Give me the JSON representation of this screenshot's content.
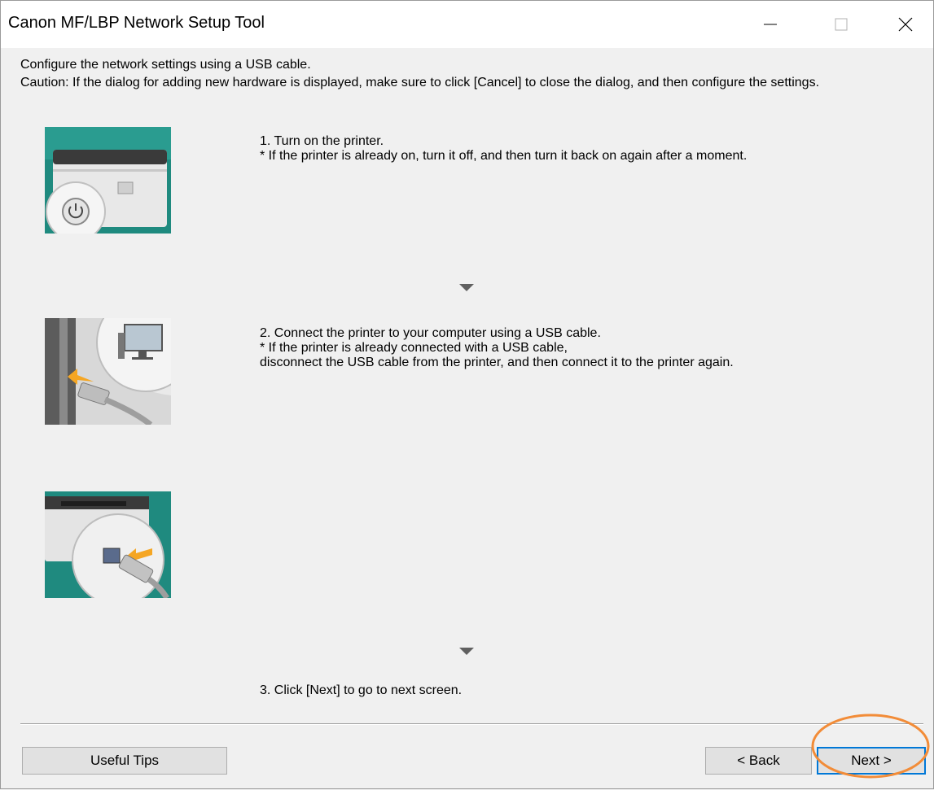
{
  "window": {
    "title": "Canon MF/LBP Network Setup Tool",
    "controls": {
      "minimize": "minimize",
      "maximize": "maximize",
      "close": "close"
    }
  },
  "intro": "Configure the network settings using a USB cable.",
  "caution": "Caution: If the dialog for adding new hardware is displayed, make sure to click [Cancel] to close the dialog, and then configure the settings.",
  "steps": [
    {
      "text": "1. Turn on the printer.\n* If the printer is already on, turn it off, and then turn it back on again after a moment."
    },
    {
      "text": "2. Connect the printer to your computer using a USB cable.\n* If the printer is already connected with a USB cable,\ndisconnect the USB cable from the printer, and then connect it to the printer again."
    },
    {
      "text": "3. Click [Next] to go to next screen."
    }
  ],
  "buttons": {
    "useful_tips": "Useful Tips",
    "back": "< Back",
    "next": "Next >"
  },
  "colors": {
    "highlight": "#f28c38",
    "accent": "#0078d7",
    "image_teal": "#1f8a7f"
  },
  "icons": [
    "minimize-icon",
    "maximize-icon",
    "close-icon",
    "power-icon",
    "monitor-icon",
    "usb-cable-icon",
    "arrow-down-icon"
  ]
}
